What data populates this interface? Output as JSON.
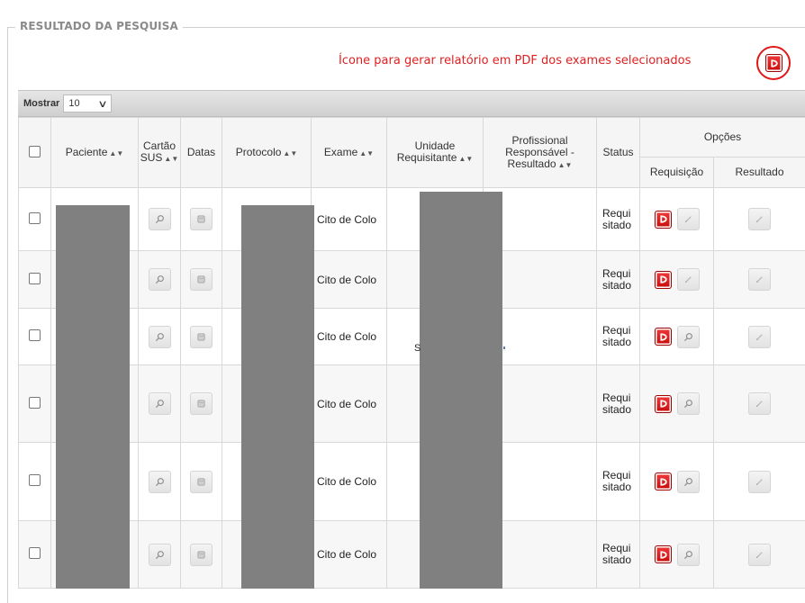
{
  "section": {
    "legend": "RESULTADO DA PESQUISA",
    "annotation": "Ícone para gerar relatório em PDF dos exames selecionados"
  },
  "toolbar": {
    "show_label": "Mostrar",
    "page_size": "10"
  },
  "table": {
    "headers": {
      "paciente": "Paciente",
      "cartao_sus": "Cartão SUS",
      "datas": "Datas",
      "protocolo": "Protocolo",
      "exame": "Exame",
      "unidade": "Unidade Requisitante",
      "profissional": "Profissional Responsável - Resultado",
      "status": "Status",
      "opcoes": "Opções",
      "requisicao": "Requisição",
      "resultado": "Resultado"
    },
    "rows": [
      {
        "exame": "Cito de Colo",
        "status": "Requi sitado",
        "req_second": "pencil-icon"
      },
      {
        "exame": "Cito de Colo",
        "status": "Requi sitado",
        "req_second": "pencil-icon"
      },
      {
        "exame": "Cito de Colo",
        "status": "Requi sitado",
        "req_second": "magnifier-icon"
      },
      {
        "exame": "Cito de Colo",
        "status": "Requi sitado",
        "req_second": "magnifier-icon"
      },
      {
        "exame": "Cito de Colo",
        "status": "Requi sitado",
        "req_second": "magnifier-icon"
      },
      {
        "exame": "Cito de Colo",
        "status": "Requi sitado",
        "req_second": "magnifier-icon"
      }
    ],
    "stray_text": "S"
  },
  "colors": {
    "annotation_red": "#e02020",
    "pdf_red": "#d01010",
    "redaction_gray": "#808080"
  }
}
